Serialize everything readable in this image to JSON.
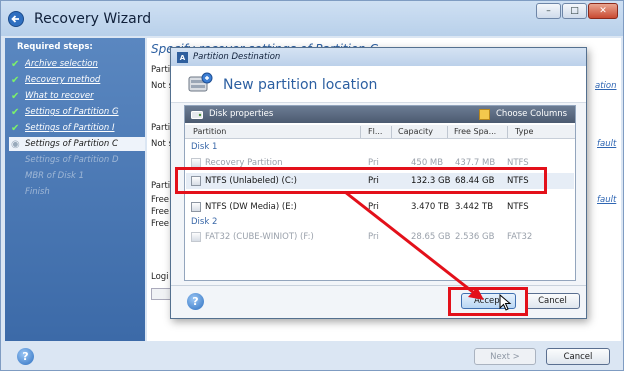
{
  "window": {
    "title": "Recovery Wizard",
    "controls": {
      "minimize": "–",
      "maximize": "□",
      "close": "✕"
    }
  },
  "sidebar": {
    "heading": "Required steps:",
    "steps": [
      {
        "label": "Archive selection",
        "state": "done"
      },
      {
        "label": "Recovery method",
        "state": "done"
      },
      {
        "label": "What to recover",
        "state": "done"
      },
      {
        "label": "Settings of Partition G",
        "state": "done"
      },
      {
        "label": "Settings of Partition I",
        "state": "done"
      },
      {
        "label": "Settings of Partition C",
        "state": "current"
      },
      {
        "label": "Settings of Partition D",
        "state": "future"
      },
      {
        "label": "MBR of Disk 1",
        "state": "future"
      },
      {
        "label": "Finish",
        "state": "future"
      }
    ]
  },
  "content": {
    "heading_partial": "Specify recover settings of Partition C",
    "fragments": [
      "Parti",
      "Not s",
      "Parti",
      "Not s",
      "Parti",
      "Free",
      "Free",
      "Free",
      "Logi"
    ],
    "link_fragments": [
      "ation",
      "fault",
      "fault"
    ]
  },
  "footer": {
    "help_symbol": "?",
    "next_label": "Next >",
    "cancel_label": "Cancel"
  },
  "dialog": {
    "title": "Partition Destination",
    "title_icon_letter": "A",
    "heading": "New partition location",
    "toolbar": {
      "disk_properties": "Disk properties",
      "choose_columns": "Choose Columns"
    },
    "columns": [
      "Partition",
      "Fl...",
      "Capacity",
      "Free Spa...",
      "Type"
    ],
    "disks": [
      {
        "label": "Disk 1",
        "partitions": [
          {
            "name": "Recovery Partition",
            "flag": "Pri",
            "capacity": "450 MB",
            "free": "437.7 MB",
            "type": "NTFS",
            "state": "disabled"
          },
          {
            "name": "NTFS (Unlabeled) (C:)",
            "flag": "Pri",
            "capacity": "132.3 GB",
            "free": "68.44 GB",
            "type": "NTFS",
            "state": "selected"
          },
          {
            "name": "NTFS (DW Media) (E:)",
            "flag": "Pri",
            "capacity": "3.470 TB",
            "free": "3.442 TB",
            "type": "NTFS",
            "state": "normal"
          }
        ]
      },
      {
        "label": "Disk 2",
        "partitions": [
          {
            "name": "FAT32 (CUBE-WINIOT) (F:)",
            "flag": "Pri",
            "capacity": "28.65 GB",
            "free": "2.536 GB",
            "type": "FAT32",
            "state": "disabled"
          }
        ]
      }
    ],
    "help_symbol": "?",
    "accept_label": "Accept",
    "cancel_label": "Cancel"
  },
  "colors": {
    "highlight": "#e3101a",
    "accent": "#2c5fa1",
    "sidebar": "#4a78b5"
  }
}
